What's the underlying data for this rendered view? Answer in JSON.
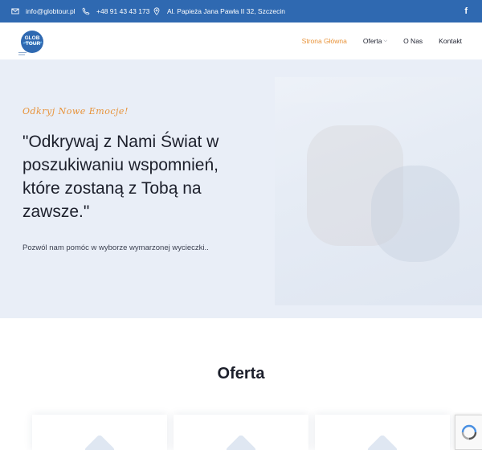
{
  "topbar": {
    "email": "info@globtour.pl",
    "phone": "+48 91 43 43 173",
    "address": "Al. Papieża Jana Pawła II 32, Szczecin",
    "email_icon": "envelope-icon",
    "phone_icon": "phone-icon",
    "address_icon": "map-pin-icon",
    "social_icon": "facebook-icon",
    "social_label": "f"
  },
  "nav": {
    "logo_text": "GLOB TOUR",
    "items": [
      {
        "label": "Strona Główna",
        "active": true
      },
      {
        "label": "Oferta",
        "has_dropdown": true
      },
      {
        "label": "O Nas"
      },
      {
        "label": "Kontakt"
      }
    ]
  },
  "hero": {
    "tagline": "Odkryj Nowe Emocje!",
    "headline": "\"Odkrywaj z Nami Świat w poszukiwaniu wspomnień, które zostaną z Tobą na zawsze.\"",
    "subtitle": "Pozwól nam pomóc w wyborze wymarzonej wycieczki.."
  },
  "offer": {
    "title": "Oferta"
  },
  "colors": {
    "topbar": "#2f69b1",
    "accent": "#e8933a",
    "hero_bg": "#e9eef7",
    "text": "#1c1f2b"
  }
}
